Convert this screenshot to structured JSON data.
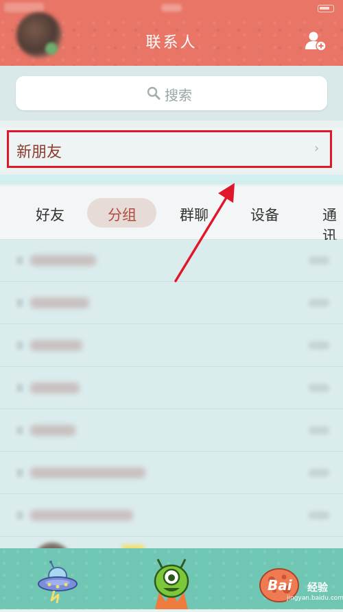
{
  "header": {
    "title": "联系人"
  },
  "search": {
    "placeholder": "搜索"
  },
  "new_friends": {
    "label": "新朋友",
    "chevron": "›"
  },
  "tabs": [
    {
      "label": "好友",
      "selected": false
    },
    {
      "label": "分组",
      "selected": true
    },
    {
      "label": "群聊",
      "selected": false
    },
    {
      "label": "设备",
      "selected": false
    },
    {
      "label": "通讯",
      "selected": false
    }
  ],
  "bottom_nav": {
    "items": [
      {
        "icon": "ufo-icon"
      },
      {
        "icon": "green-monster-icon"
      },
      {
        "icon": "orange-planet-icon"
      }
    ]
  },
  "watermark": {
    "brand": "Bai",
    "cn": "经验",
    "url": "jingyan.baidu.com"
  },
  "colors": {
    "header": "#e87566",
    "bottom_bar": "#6ec6b3",
    "highlight": "#e0162b",
    "selected_tab_text": "#b24a3c"
  }
}
